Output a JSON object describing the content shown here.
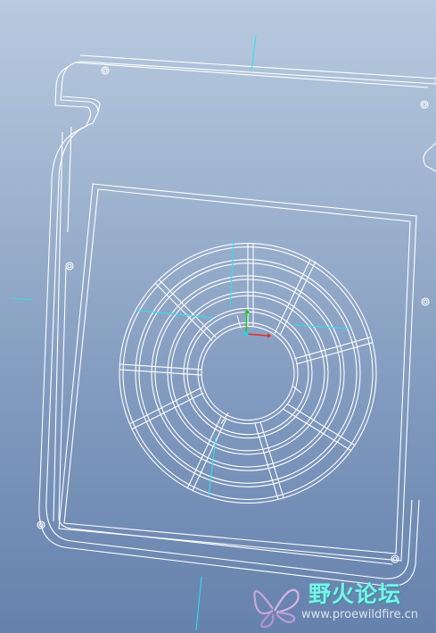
{
  "app": {
    "viewport_label": "3D model viewport",
    "background_colors": [
      "#b7cadf",
      "#7f98bd",
      "#6582ad"
    ],
    "line_color": "#ffffff",
    "axis_colors": {
      "x": "#e0302a",
      "y": "#22c422",
      "z": "#22d8e6",
      "datum": "#28e6f0"
    }
  },
  "watermark": {
    "title": "野火论坛",
    "url": "www.proewildfire.cn",
    "logo_icon": "butterfly-logo-icon"
  }
}
